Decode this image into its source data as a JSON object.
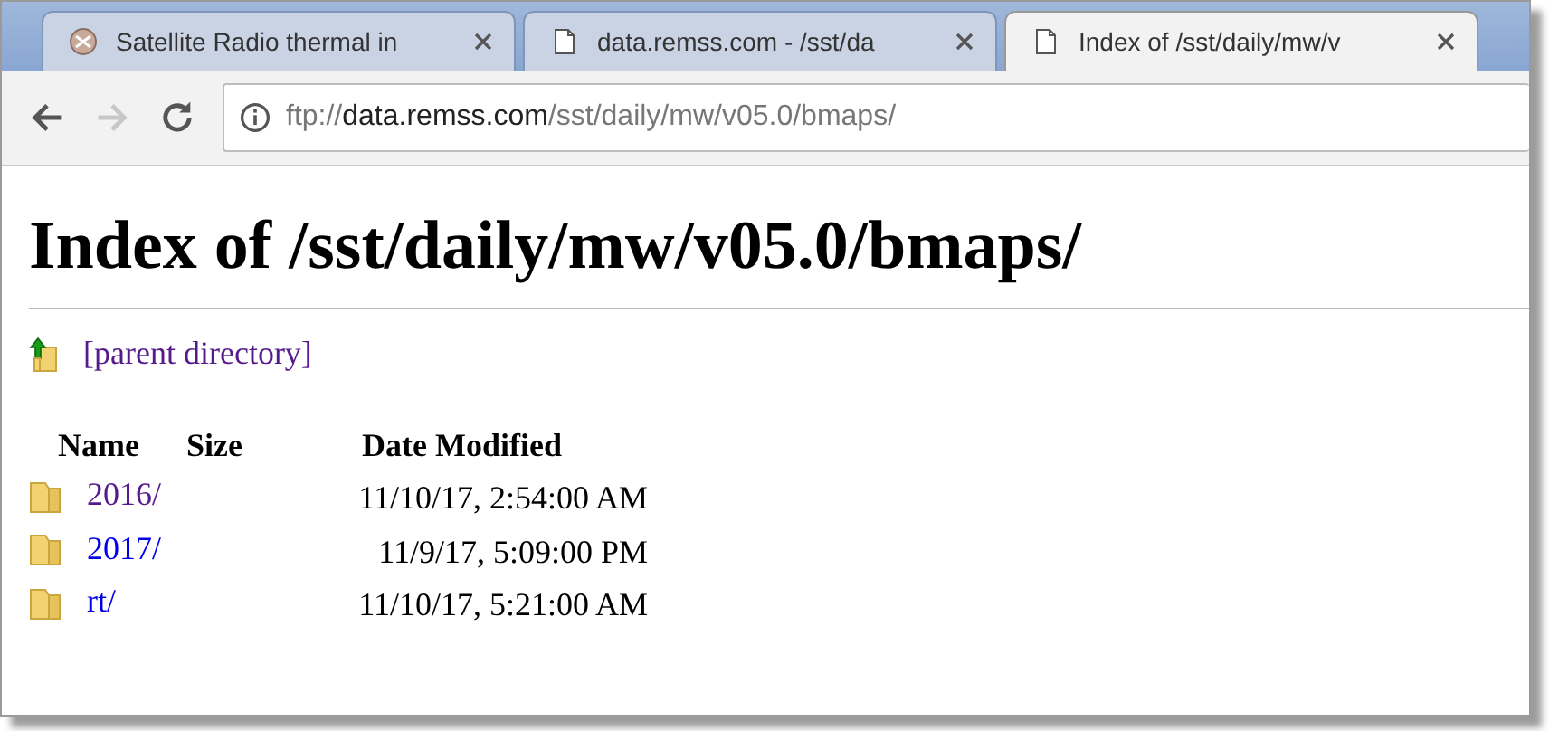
{
  "tabs": [
    {
      "title": "Satellite Radio thermal in",
      "kind": "site",
      "selected": false
    },
    {
      "title": "data.remss.com - /sst/da",
      "kind": "page",
      "selected": false
    },
    {
      "title": "Index of /sst/daily/mw/v",
      "kind": "page",
      "selected": true
    }
  ],
  "address": {
    "scheme": "ftp://",
    "host": "data.remss.com",
    "path": "/sst/daily/mw/v05.0/bmaps/"
  },
  "heading": "Index of /sst/daily/mw/v05.0/bmaps/",
  "parent_link": {
    "label": "[parent directory]",
    "visited": true
  },
  "table": {
    "columns": [
      "Name",
      "Size",
      "Date Modified"
    ],
    "rows": [
      {
        "name": "2016/",
        "visited": true,
        "date": "11/10/17, 2:54:00 AM"
      },
      {
        "name": "2017/",
        "visited": false,
        "date": "11/9/17, 5:09:00 PM"
      },
      {
        "name": "rt/",
        "visited": false,
        "date": "11/10/17, 5:21:00 AM"
      }
    ]
  }
}
